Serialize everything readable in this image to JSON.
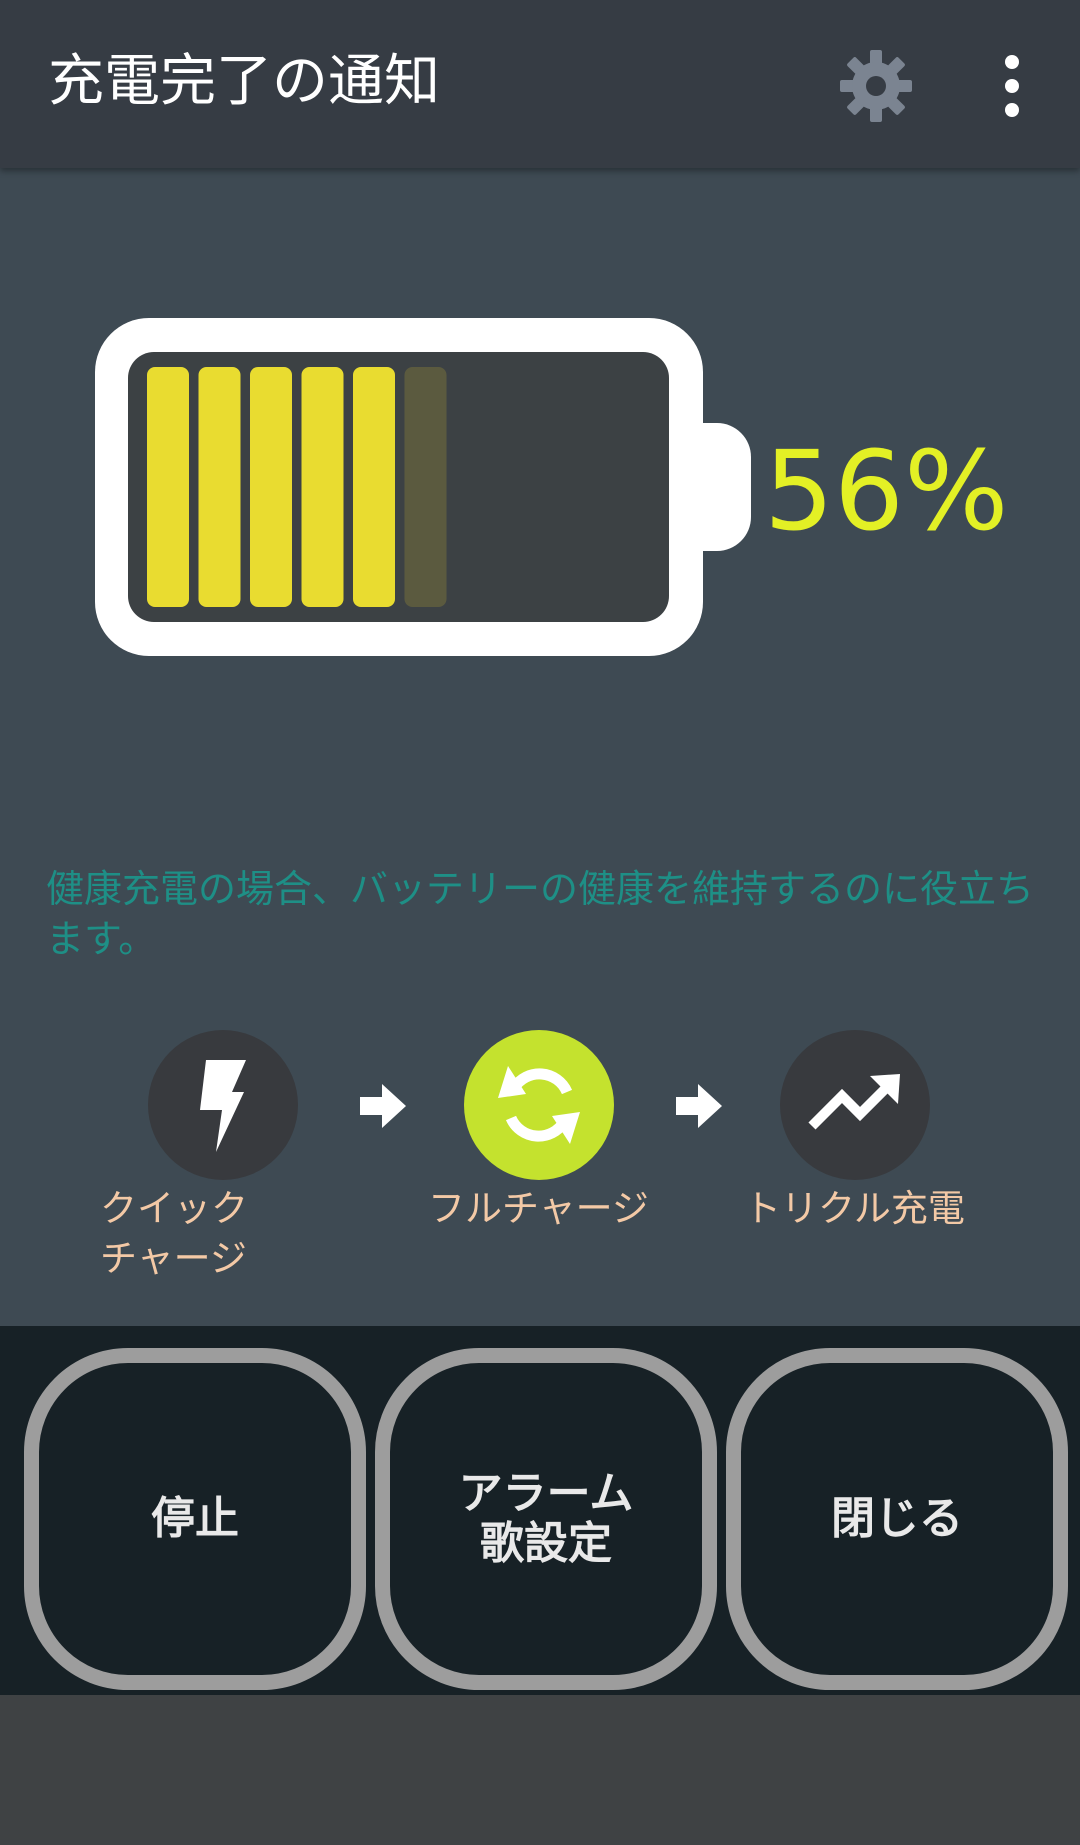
{
  "app_bar": {
    "title": "充電完了の通知",
    "settings_icon": "gear-icon",
    "overflow_icon": "more-vert-icon"
  },
  "battery": {
    "level_percent": 56,
    "percent_text": "56%",
    "bars_full": 5,
    "bars_partial": 1,
    "bars_total": 10,
    "fill_color": "#e9dc30",
    "partial_color": "#5b5a3f",
    "text_color": "#e3f025"
  },
  "health_text": "健康充電の場合、バッテリーの健康を維持するのに役立ちます。",
  "modes": [
    {
      "icon": "lightning-icon",
      "label_line1": "クイック",
      "label_line2": "チャージ",
      "active": false
    },
    {
      "icon": "sync-icon",
      "label": "フルチャージ",
      "active": true
    },
    {
      "icon": "trending-up-icon",
      "label": "トリクル充電",
      "active": false
    }
  ],
  "buttons": {
    "stop": "停止",
    "alarm_line1": "アラーム",
    "alarm_line2": "歌設定",
    "close": "閉じる"
  },
  "colors": {
    "accent_green": "#c4e22e",
    "teal_text": "#1e8f86",
    "label_peach": "#f3c9a6"
  }
}
